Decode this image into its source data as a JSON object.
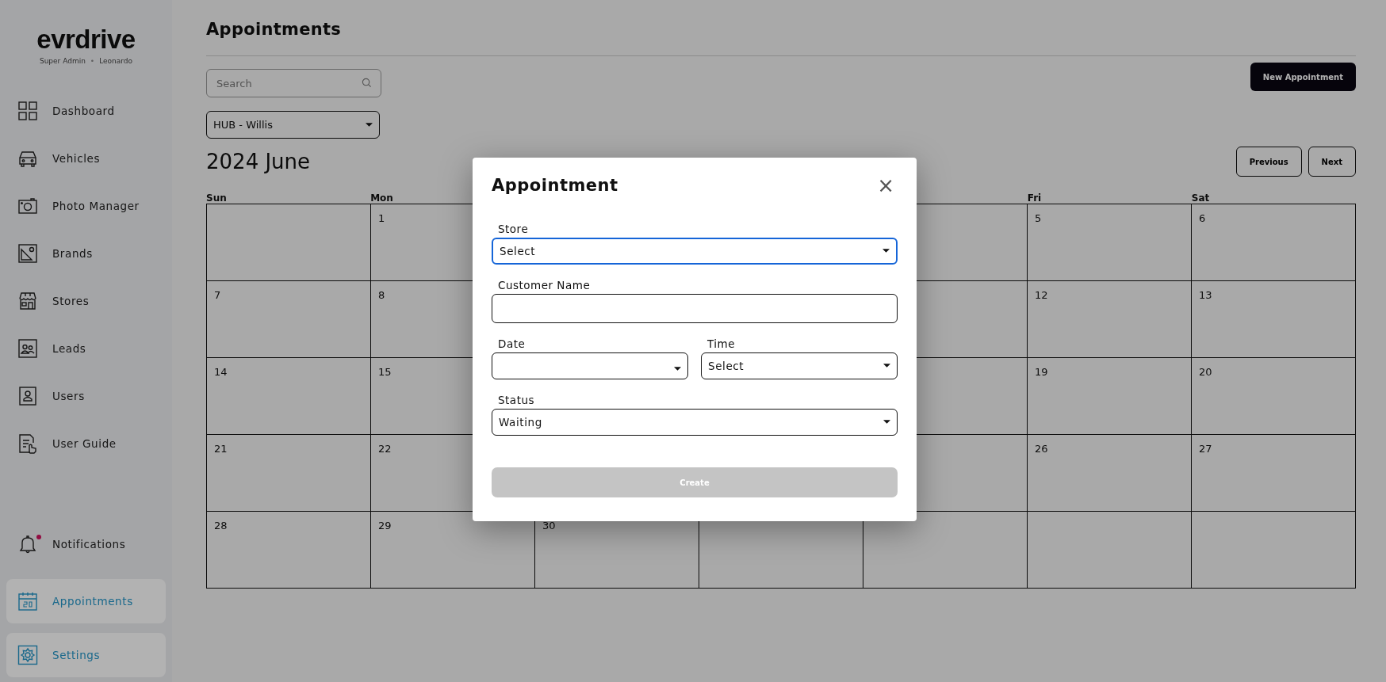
{
  "sidebar": {
    "logo": "evrdrive",
    "role": "Super Admin",
    "separator": "•",
    "user": "Leonardo",
    "items": [
      {
        "label": "Dashboard",
        "kind": "grid",
        "selected": false
      },
      {
        "label": "Vehicles",
        "kind": "car",
        "selected": false
      },
      {
        "label": "Photo Manager",
        "kind": "camera",
        "selected": false
      },
      {
        "label": "Brands",
        "kind": "image",
        "selected": false
      },
      {
        "label": "Stores",
        "kind": "store",
        "selected": false
      },
      {
        "label": "Leads",
        "kind": "people",
        "selected": false
      },
      {
        "label": "Users",
        "kind": "person",
        "selected": false
      },
      {
        "label": "User Guide",
        "kind": "doc",
        "selected": false
      }
    ],
    "bottom_items": [
      {
        "label": "Notifications",
        "kind": "bell",
        "selected": false,
        "badge": true
      },
      {
        "label": "Appointments",
        "kind": "calendar",
        "selected": true
      },
      {
        "label": "Settings",
        "kind": "gear",
        "selected": true
      }
    ]
  },
  "main": {
    "title": "Appointments",
    "search": {
      "placeholder": "Search"
    },
    "new_button": "New Appointment",
    "store_filter": "HUB - Willis",
    "month": "2024 June",
    "previous": "Previous",
    "next": "Next",
    "calendar": {
      "weekdays": {
        "sun": "Sun",
        "mon": "Mon",
        "fri": "Fri",
        "sat": "Sat"
      },
      "weeks": [
        {
          "mon": "1",
          "fri": "5",
          "sat": "6"
        },
        {
          "sun": "7",
          "mon": "8",
          "fri": "12",
          "sat": "13"
        },
        {
          "sun": "14",
          "mon": "15",
          "fri": "19",
          "sat": "20"
        },
        {
          "sun": "21",
          "mon": "22",
          "fri": "26",
          "sat": "27"
        },
        {
          "sun": "28",
          "mon": "29",
          "tue": "30"
        }
      ]
    }
  },
  "modal": {
    "title": "Appointment",
    "close": "×",
    "rows": [
      [
        {
          "label": "Store",
          "kind": "select",
          "value": "Select",
          "focused": true
        }
      ],
      [
        {
          "label": "Customer Name",
          "kind": "text",
          "focused": false
        }
      ],
      [
        {
          "label": "Date",
          "kind": "select",
          "focused": false
        },
        {
          "label": "Time",
          "kind": "select",
          "value": "Select",
          "focused": false
        }
      ],
      [
        {
          "label": "Status",
          "kind": "select",
          "value": "Waiting",
          "focused": false
        }
      ]
    ],
    "submit": {
      "label": "Create",
      "disabled": true
    }
  }
}
